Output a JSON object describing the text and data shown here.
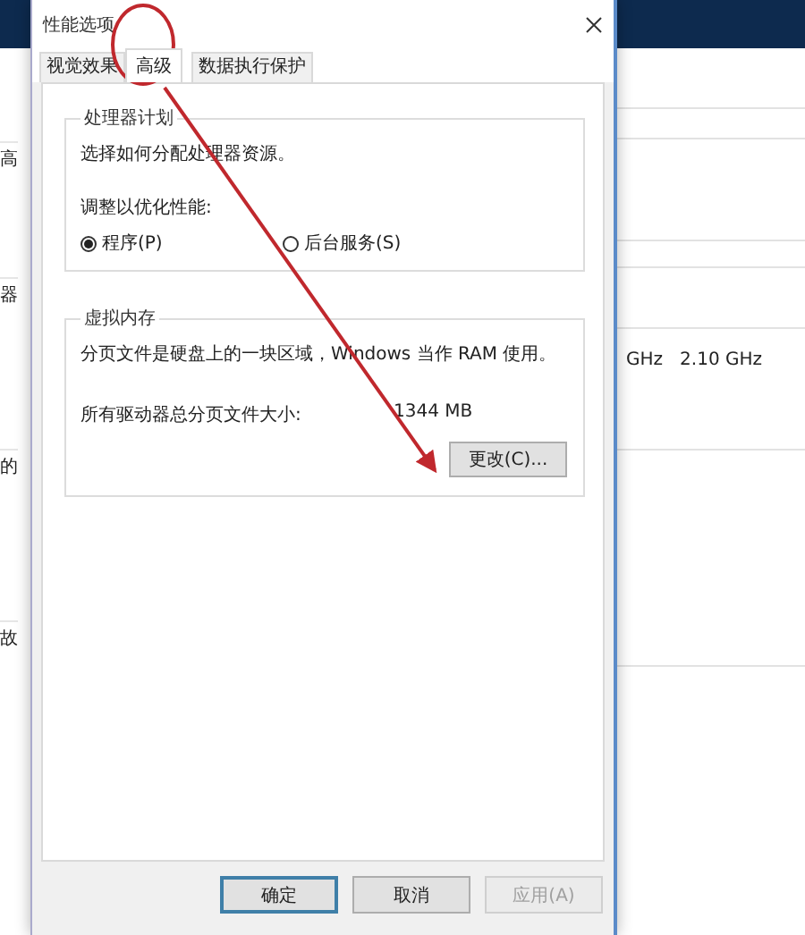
{
  "background_window": {
    "left_fragments": [
      "高",
      "器",
      "的",
      "故"
    ],
    "right_fragment": "GHz   2.10 GHz"
  },
  "dialog": {
    "title": "性能选项",
    "tabs": [
      {
        "label": "视觉效果",
        "selected": false
      },
      {
        "label": "高级",
        "selected": true
      },
      {
        "label": "数据执行保护",
        "selected": false
      }
    ],
    "processor_scheduling": {
      "title": "处理器计划",
      "description": "选择如何分配处理器资源。",
      "adjust_label": "调整以优化性能:",
      "options": [
        {
          "label": "程序(P)",
          "selected": true
        },
        {
          "label": "后台服务(S)",
          "selected": false
        }
      ]
    },
    "virtual_memory": {
      "title": "虚拟内存",
      "description": "分页文件是硬盘上的一块区域，Windows 当作 RAM 使用。",
      "total_label": "所有驱动器总分页文件大小:",
      "total_value": "1344 MB",
      "change_button": "更改(C)..."
    },
    "buttons": [
      {
        "label": "确定",
        "focused": true,
        "disabled": false
      },
      {
        "label": "取消",
        "focused": false,
        "disabled": false
      },
      {
        "label": "应用(A)",
        "focused": false,
        "disabled": true
      }
    ]
  }
}
